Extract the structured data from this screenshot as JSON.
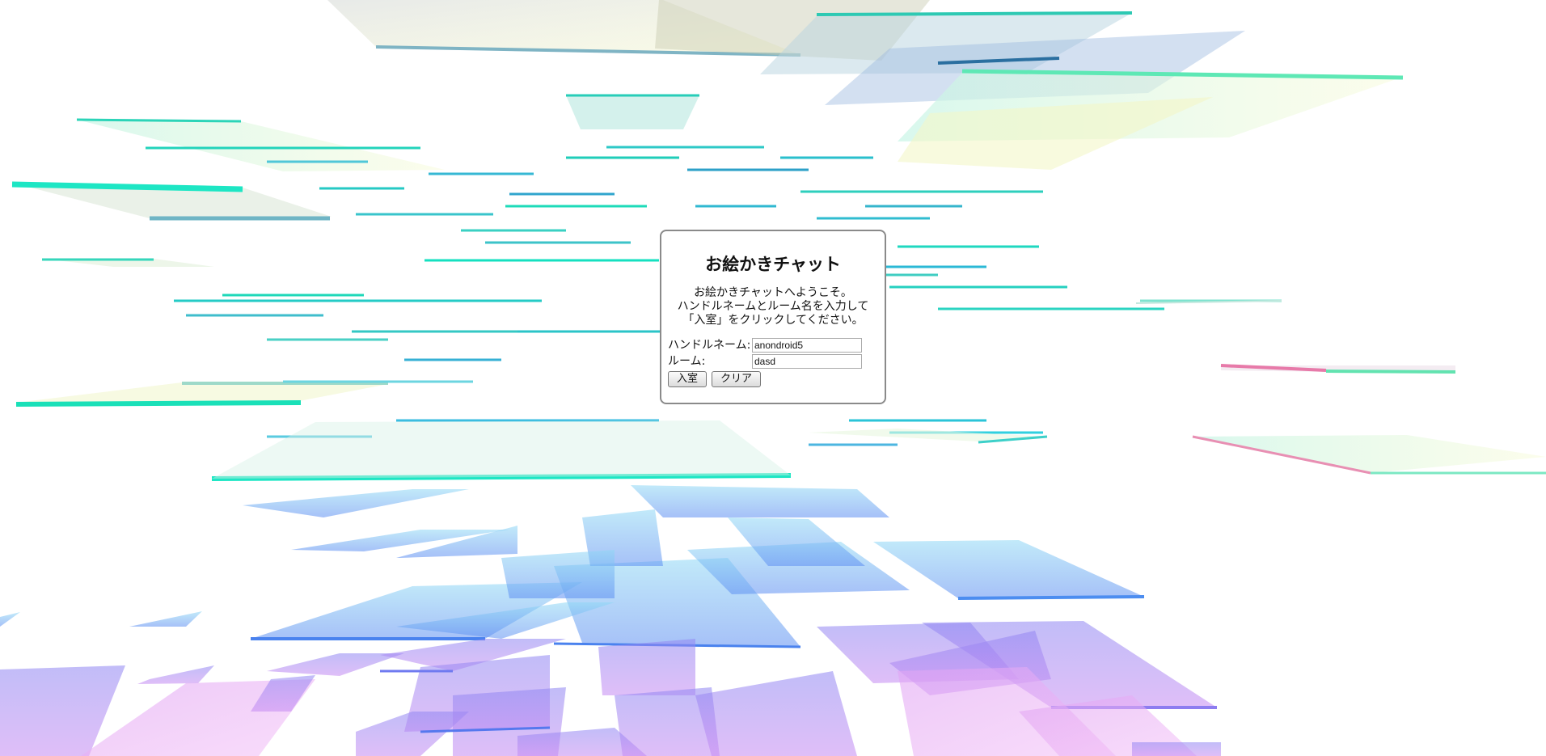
{
  "dialog": {
    "title": "お絵かきチャット",
    "welcome_lines": [
      "お絵かきチャットへようこそ。",
      "ハンドルネームとルーム名を入力して",
      "「入室」をクリックしてください。"
    ],
    "handle_label": "ハンドルネーム:",
    "handle_value": "anondroid5",
    "room_label": "ルーム:",
    "room_value": "dasd",
    "enter_button": "入室",
    "clear_button": "クリア"
  },
  "background": {
    "style": "3D floating translucent panels",
    "colors": [
      "#1de6c4",
      "#7fd8f0",
      "#5aa8f5",
      "#6f6cf0",
      "#b98af2",
      "#e7a0f5",
      "#f5f7c8",
      "#e97aa8"
    ]
  }
}
